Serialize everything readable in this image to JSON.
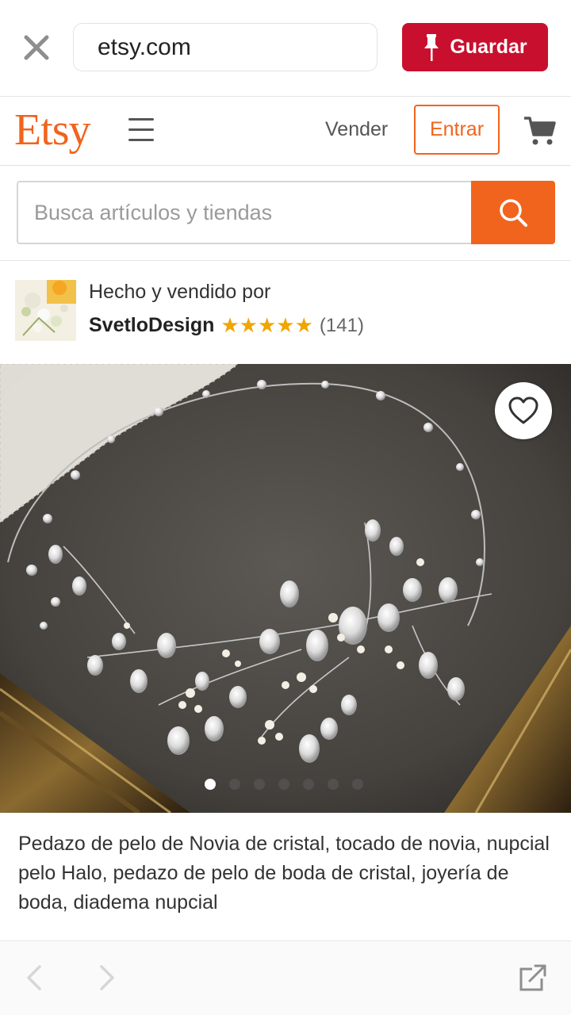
{
  "browser": {
    "url": "etsy.com",
    "save_label": "Guardar"
  },
  "header": {
    "logo": "Etsy",
    "sell_label": "Vender",
    "signin_label": "Entrar"
  },
  "search": {
    "placeholder": "Busca artículos y tiendas"
  },
  "seller": {
    "made_by_label": "Hecho y vendido por",
    "shop_name": "SvetloDesign",
    "stars": "★★★★★",
    "rating": 5,
    "review_count": "(141)"
  },
  "product": {
    "title": "Pedazo de pelo de Novia de cristal, tocado de novia, nupcial pelo Halo, pedazo de pelo de boda de cristal, joyería de boda, diadema nupcial",
    "image_count": 7,
    "active_image_index": 0
  },
  "colors": {
    "etsy_orange": "#f1641e",
    "pinterest_red": "#c8102e",
    "star_gold": "#f0a500"
  },
  "icons": [
    "close-icon",
    "pin-icon",
    "menu-icon",
    "cart-icon",
    "search-icon",
    "heart-icon",
    "chevron-left-icon",
    "chevron-right-icon",
    "open-external-icon"
  ]
}
